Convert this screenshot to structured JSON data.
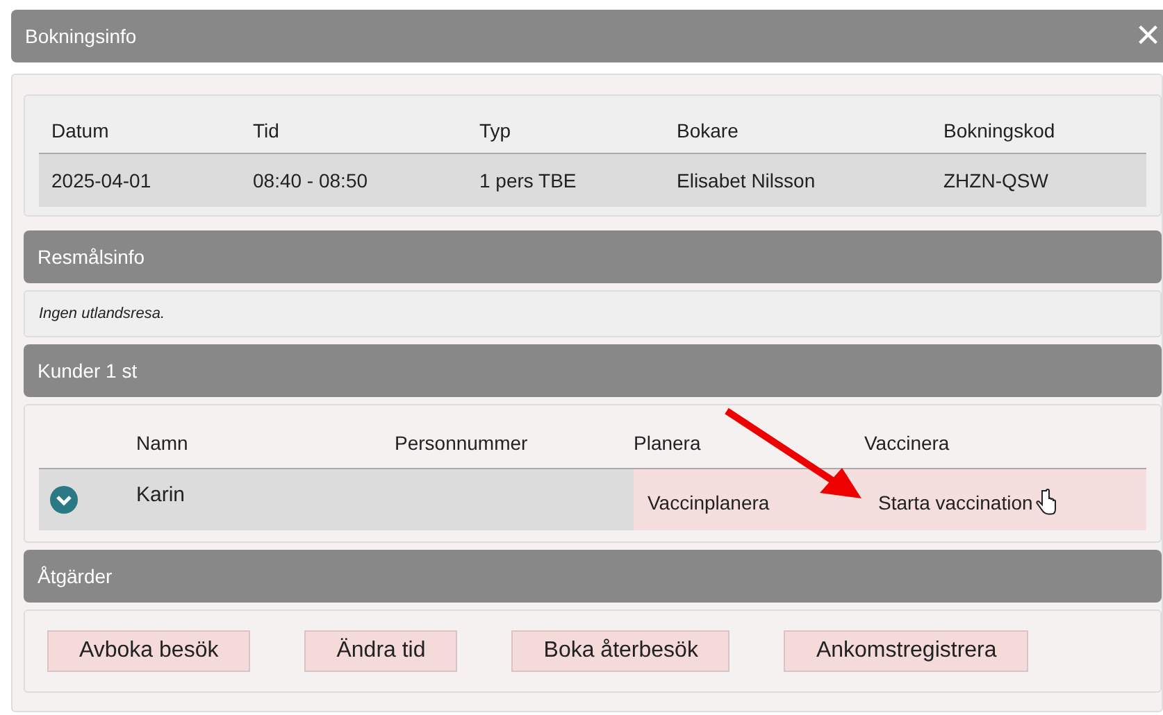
{
  "window": {
    "title": "Bokningsinfo",
    "close": "×"
  },
  "booking": {
    "columns": [
      "Datum",
      "Tid",
      "Typ",
      "Bokare",
      "Bokningskod"
    ],
    "row": [
      "2025-04-01",
      "08:40 - 08:50",
      "1 pers TBE",
      "Elisabet Nilsson",
      "ZHZN-QSW"
    ]
  },
  "destination": {
    "title": "Resmålsinfo",
    "text": "Ingen utlandsresa."
  },
  "customers": {
    "title": "Kunder 1 st",
    "columns": [
      "Namn",
      "Personnummer",
      "Planera",
      "Vaccinera"
    ],
    "rows": [
      {
        "name": "Karin",
        "plan": "Vaccinplanera",
        "vaccinate": "Starta vaccination"
      }
    ]
  },
  "actions": {
    "title": "Åtgärder",
    "buttons": [
      "Avboka besök",
      "Ändra tid",
      "Boka återbesök",
      "Ankomstregistrera"
    ]
  }
}
